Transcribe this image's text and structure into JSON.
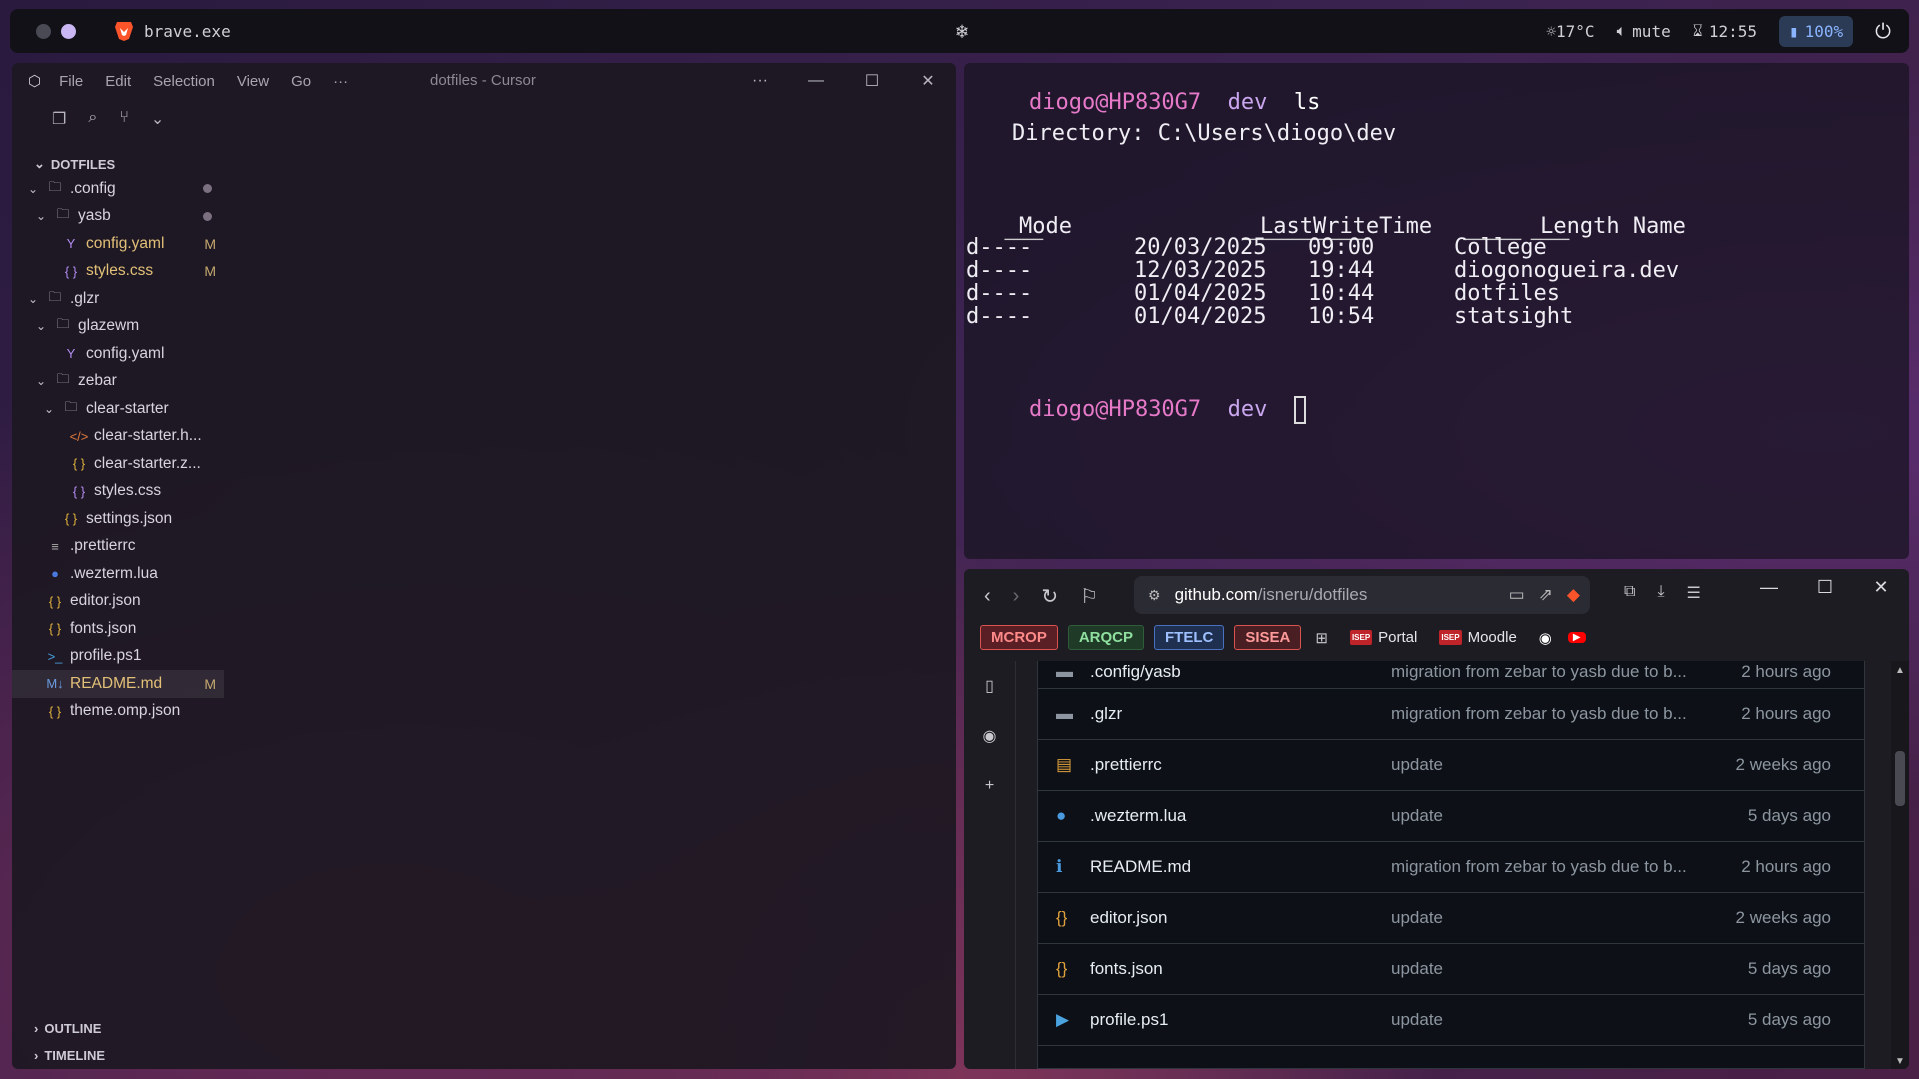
{
  "topbar": {
    "app_title": "brave.exe",
    "center_icon": "snowflake-icon",
    "weather": "☼17°C",
    "volume": "mute",
    "clock": "12:55",
    "battery": "100%",
    "power_icon": "power-icon"
  },
  "editor": {
    "menu": [
      "File",
      "Edit",
      "Selection",
      "View",
      "Go",
      "···"
    ],
    "title": "dotfiles - Cursor",
    "explorer_label": "DOTFILES",
    "tree": [
      {
        "label": ".config",
        "kind": "folder",
        "depth": 0,
        "open": true,
        "dot": true
      },
      {
        "label": "yasb",
        "kind": "folder",
        "depth": 1,
        "open": true,
        "dot": true
      },
      {
        "label": "config.yaml",
        "kind": "yaml",
        "depth": 2,
        "status": "M"
      },
      {
        "label": "styles.css",
        "kind": "css",
        "depth": 2,
        "status": "M"
      },
      {
        "label": ".glzr",
        "kind": "folder",
        "depth": 0,
        "open": true
      },
      {
        "label": "glazewm",
        "kind": "folder",
        "depth": 1,
        "open": true
      },
      {
        "label": "config.yaml",
        "kind": "yaml",
        "depth": 2
      },
      {
        "label": "zebar",
        "kind": "folder",
        "depth": 1,
        "open": true
      },
      {
        "label": "clear-starter",
        "kind": "folder",
        "depth": 2,
        "open": true
      },
      {
        "label": "clear-starter.h...",
        "kind": "html",
        "depth": 3
      },
      {
        "label": "clear-starter.z...",
        "kind": "json",
        "depth": 3
      },
      {
        "label": "styles.css",
        "kind": "css",
        "depth": 3
      },
      {
        "label": "settings.json",
        "kind": "json",
        "depth": 2
      },
      {
        "label": ".prettierrc",
        "kind": "prettier",
        "depth": 0
      },
      {
        "label": ".wezterm.lua",
        "kind": "lua",
        "depth": 0
      },
      {
        "label": "editor.json",
        "kind": "json",
        "depth": 0
      },
      {
        "label": "fonts.json",
        "kind": "json",
        "depth": 0
      },
      {
        "label": "profile.ps1",
        "kind": "ps1",
        "depth": 0
      },
      {
        "label": "README.md",
        "kind": "md",
        "depth": 0,
        "status": "M",
        "selected": true
      },
      {
        "label": "theme.omp.json",
        "kind": "json",
        "depth": 0
      }
    ],
    "outline_label": "OUTLINE",
    "timeline_label": "TIMELINE"
  },
  "terminal": {
    "user": "diogo@HP830G7",
    "dir": "dev",
    "command": "ls",
    "directory_line": "Directory: C:\\Users\\diogo\\dev",
    "headers": {
      "mode": "Mode",
      "lwt": "LastWriteTime",
      "length": "Length",
      "name": "Name"
    },
    "underlines": {
      "mode": "────",
      "lwt": "─────────────",
      "length": "──────",
      "name": "────"
    },
    "rows": [
      {
        "mode": "d----",
        "date": "20/03/2025",
        "time": "09:00",
        "name": "College"
      },
      {
        "mode": "d----",
        "date": "12/03/2025",
        "time": "19:44",
        "name": "diogonogueira.dev"
      },
      {
        "mode": "d----",
        "date": "01/04/2025",
        "time": "10:44",
        "name": "dotfiles"
      },
      {
        "mode": "d----",
        "date": "01/04/2025",
        "time": "10:54",
        "name": "statsight"
      }
    ]
  },
  "browser": {
    "url_host": "github.com",
    "url_path": "/isneru/dotfiles",
    "bookmarks": [
      {
        "label": "MCROP",
        "bg": "#5a1f24",
        "fg": "#ff8a8a",
        "border": "#d9534f"
      },
      {
        "label": "ARQCP",
        "bg": "#1f3a26",
        "fg": "#8fe0a0",
        "border": "#2f5d3a"
      },
      {
        "label": "FTELC",
        "bg": "#1f2f4f",
        "fg": "#9fc0ff",
        "border": "#4a70c0"
      },
      {
        "label": "SISEA",
        "bg": "#4a1f24",
        "fg": "#ff9a9a",
        "border": "#d9534f"
      }
    ],
    "links": [
      {
        "label": "Portal",
        "badge": "ISEP"
      },
      {
        "label": "Moodle",
        "badge": "ISEP"
      }
    ],
    "files": [
      {
        "name": ".config/yasb",
        "icon": "folder-icon",
        "msg": "migration from zebar to yasb due to b...",
        "time": "2 hours ago"
      },
      {
        "name": ".glzr",
        "icon": "folder-icon",
        "msg": "migration from zebar to yasb due to b...",
        "time": "2 hours ago"
      },
      {
        "name": ".prettierrc",
        "icon": "prettier-icon",
        "msg": "update",
        "time": "2 weeks ago"
      },
      {
        "name": ".wezterm.lua",
        "icon": "lua-icon",
        "msg": "update",
        "time": "5 days ago"
      },
      {
        "name": "README.md",
        "icon": "info-icon",
        "msg": "migration from zebar to yasb due to b...",
        "time": "2 hours ago"
      },
      {
        "name": "editor.json",
        "icon": "json-icon",
        "msg": "update",
        "time": "2 weeks ago"
      },
      {
        "name": "fonts.json",
        "icon": "json-icon",
        "msg": "update",
        "time": "5 days ago"
      },
      {
        "name": "profile.ps1",
        "icon": "powershell-icon",
        "msg": "update",
        "time": "5 days ago"
      }
    ]
  }
}
